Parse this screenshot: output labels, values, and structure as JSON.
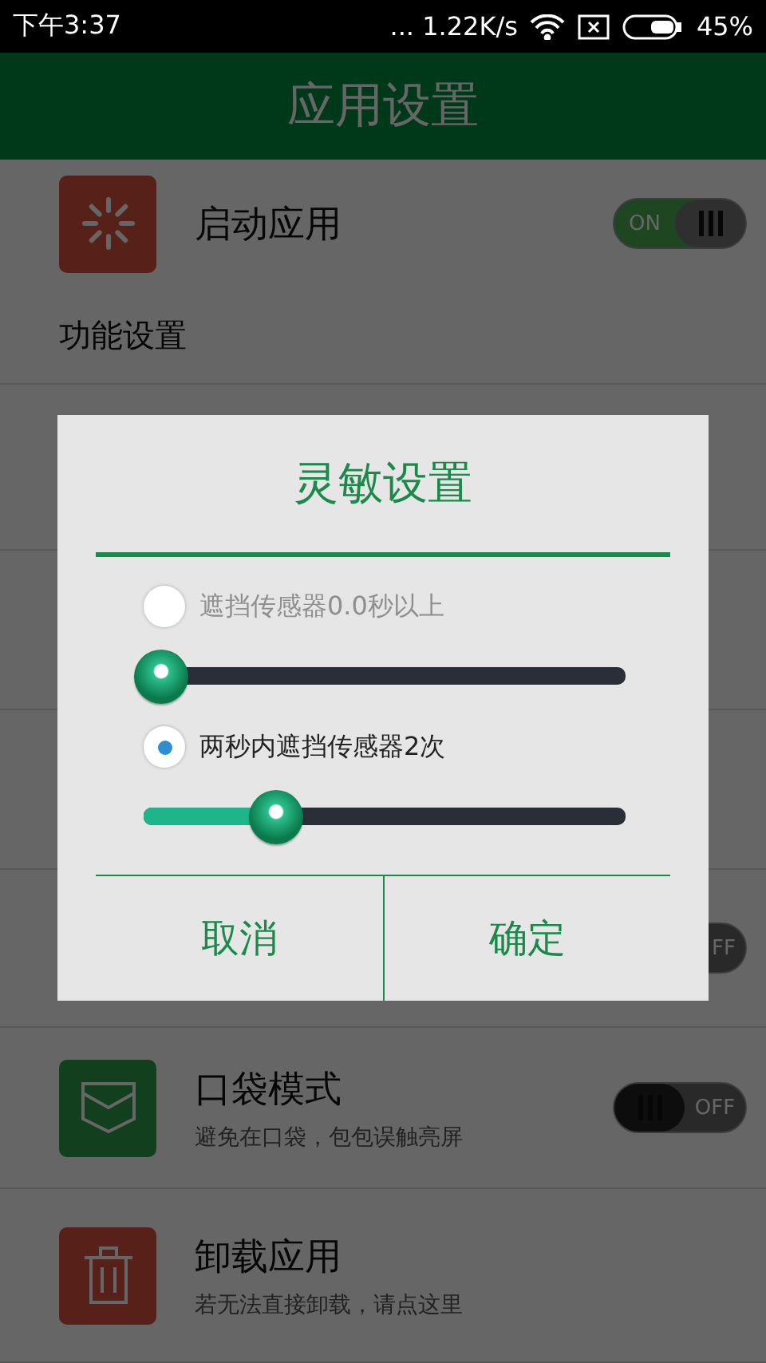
{
  "status_bar": {
    "time": "下午3:37",
    "network": "... 1.22K/s",
    "battery": "45%"
  },
  "app_bar": {
    "title": "应用设置"
  },
  "launch_row": {
    "title": "启动应用",
    "toggle": {
      "on": true,
      "label": "ON"
    }
  },
  "section_header": "功能设置",
  "covered_toggle": {
    "on": false,
    "label": "FF"
  },
  "rows": [
    {
      "kind": "switch",
      "title": "口袋模式",
      "subtitle": "避免在口袋，包包误触亮屏",
      "toggle": {
        "on": false,
        "label": "OFF"
      }
    },
    {
      "kind": "action",
      "title": "卸载应用",
      "subtitle": "若无法直接卸载，请点这里"
    }
  ],
  "dialog": {
    "title": "灵敏设置",
    "options": [
      {
        "label": "遮挡传感器0.0秒以上",
        "selected": false,
        "disabled": true,
        "level": 0
      },
      {
        "label": "两秒内遮挡传感器2次",
        "selected": true,
        "disabled": false,
        "level": 0.27
      }
    ],
    "buttons": [
      "取消",
      "确定"
    ]
  }
}
